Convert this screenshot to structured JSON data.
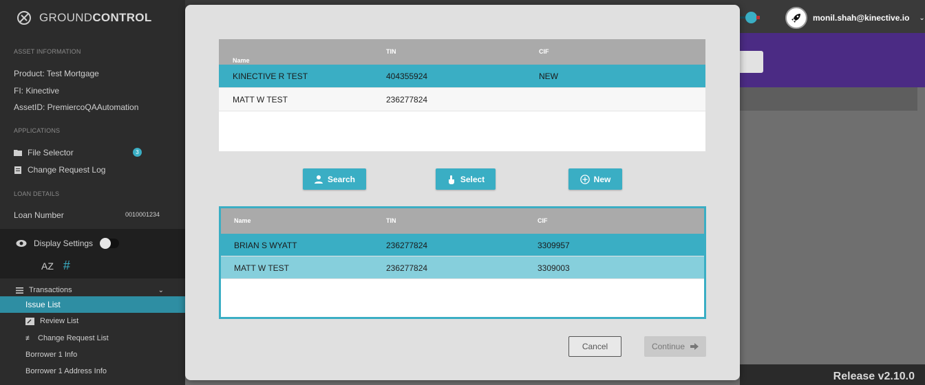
{
  "app": {
    "brand_light": "GROUND",
    "brand_bold": "CONTROL",
    "release": "Release v2.10.0",
    "user": "monil.shah@kinective.io"
  },
  "sidebar": {
    "asset_title": "ASSET INFORMATION",
    "product": "Product:  Test Mortgage",
    "fi": "FI:  Kinective",
    "asset_id": "AssetID:  PremiercoQAAutomation",
    "applications_title": "APPLICATIONS",
    "file_selector": "File Selector",
    "file_selector_badge": "3",
    "change_request_log": "Change Request Log",
    "loan_title": "LOAN DETAILS",
    "loan_number_label": "Loan Number",
    "loan_number_value": "0010001234",
    "display_settings": "Display Settings",
    "sort_az": "AZ",
    "hash": "#",
    "transactions": "Transactions",
    "issue_list": "Issue List",
    "review_list": "Review List",
    "change_request_list": "Change Request List",
    "borrower_info": "Borrower 1 Info",
    "borrower_address": "Borrower 1 Address Info"
  },
  "modal": {
    "table1": {
      "headers": [
        "Name",
        "TIN",
        "CIF"
      ],
      "rows": [
        [
          "KINECTIVE R TEST",
          "404355924",
          "NEW"
        ],
        [
          "MATT W TEST",
          "236277824",
          ""
        ]
      ]
    },
    "buttons": {
      "search": "Search",
      "select": "Select",
      "new": "New"
    },
    "table2": {
      "headers": [
        "Name",
        "TIN",
        "CIF"
      ],
      "rows": [
        [
          "BRIAN S WYATT",
          "236277824",
          "3309957"
        ],
        [
          "MATT W TEST",
          "236277824",
          "3309003"
        ]
      ]
    },
    "cancel": "Cancel",
    "continue": "Continue"
  },
  "colors": {
    "accent": "#3aaec4",
    "sidebar_bg": "#2c2c2c",
    "purple": "#4b2b84"
  }
}
